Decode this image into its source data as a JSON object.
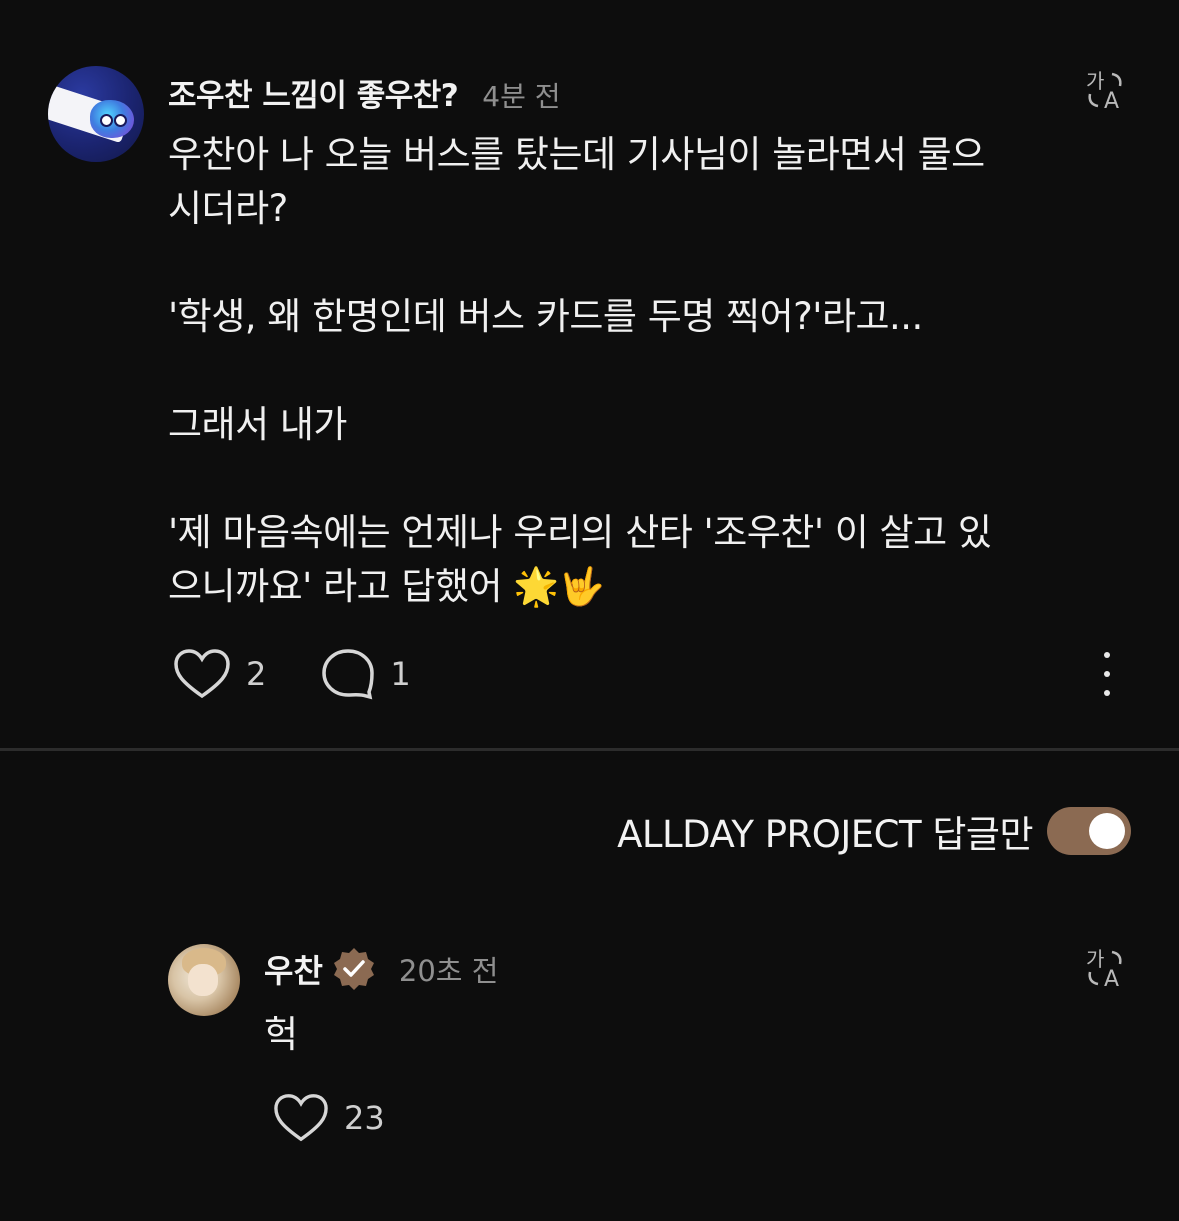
{
  "post": {
    "username": "조우찬 느낌이 좋우찬?",
    "time": "4분 전",
    "body": {
      "line1": "우찬아 나 오늘 버스를 탔는데 기사님이 놀라면서 물으",
      "line2": "시더라?",
      "line3": "'학생, 왜 한명인데 버스 카드를 두명 찍어?'라고...",
      "line4": "그래서 내가",
      "line5": "'제 마음속에는 언제나 우리의 산타 '조우찬' 이 살고 있",
      "line6": "으니까요' 라고 답했어 🌟🤟"
    },
    "likes": "2",
    "comments": "1",
    "icons": {
      "translate": "translate-icon",
      "like": "heart-icon",
      "comment": "comment-icon",
      "more": "more-icon"
    }
  },
  "filter": {
    "label": "ALLDAY PROJECT 답글만",
    "enabled": true,
    "color": "#8b6a52"
  },
  "reply": {
    "username": "우찬",
    "verified": true,
    "time": "20초 전",
    "text": "헉",
    "likes": "23"
  }
}
